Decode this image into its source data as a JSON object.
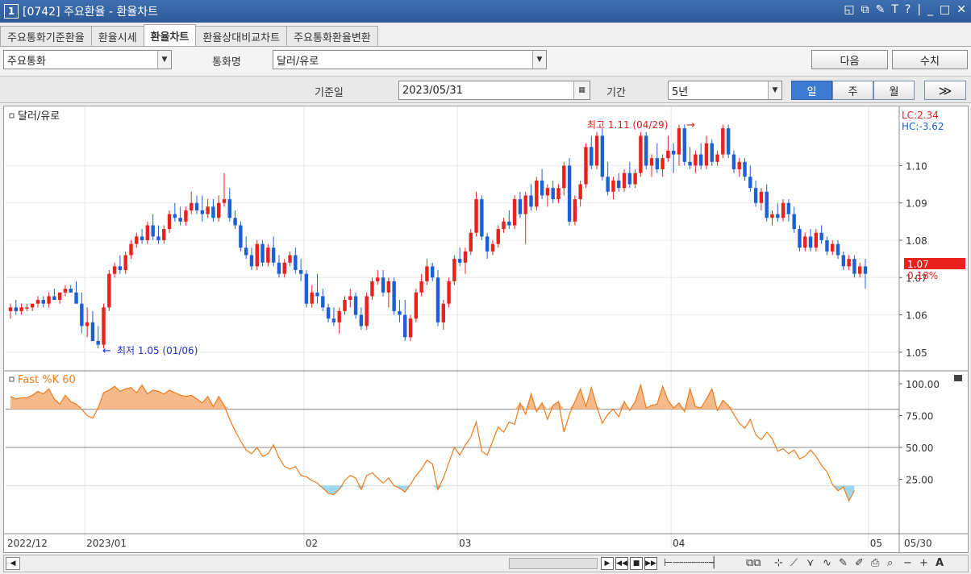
{
  "window": {
    "number": "1",
    "title": "[0742] 주요환율 - 환율차트"
  },
  "title_tools": [
    "◱",
    "⧉",
    "✎",
    "T",
    "?",
    "|",
    "_",
    "□",
    "✕"
  ],
  "tabs": [
    "주요통화기준환율",
    "환율시세",
    "환율차트",
    "환율상대비교차트",
    "주요통화환율변환"
  ],
  "active_tab": 2,
  "filters": {
    "category_value": "주요통화",
    "currency_label": "통화명",
    "currency_value": "달러/유로",
    "next_button": "다음",
    "value_button": "수치",
    "base_date_label": "기준일",
    "base_date_value": "2023/05/31",
    "period_label": "기간",
    "period_value": "5년",
    "period_buttons": [
      "일",
      "주",
      "월"
    ],
    "active_period": 0,
    "more_button": "≫"
  },
  "chart": {
    "series_title": "달러/유로",
    "lc_label": "LC:2.34",
    "hc_label": "HC:-3.62",
    "high_annotation": "최고 1.11 (04/29)",
    "low_annotation": "최저 1.05 (01/06)",
    "price_ticks": [
      "1.10",
      "1.09",
      "1.08",
      "1.07",
      "1.06",
      "1.05"
    ],
    "last_price": "1.07",
    "last_change": "0.18%",
    "osc_title": "Fast %K 60",
    "osc_ticks": [
      "100.00",
      "75.00",
      "50.00",
      "25.00"
    ],
    "date_labels": [
      "2022/12",
      "2023/01",
      "02",
      "03",
      "04",
      "05",
      "05/30"
    ],
    "colors": {
      "up": "#e8231e",
      "down": "#1e5fd6",
      "osc_line": "#f07b1c",
      "osc_fill": "#f5b98a",
      "osc_low_fill": "#9ed7f0",
      "high_text": "#d62020",
      "low_text": "#1e30c8"
    }
  },
  "chart_data": {
    "type": "candlestick",
    "y_range": [
      1.045,
      1.115
    ],
    "candles": [
      [
        1.061,
        1.063,
        1.059,
        1.062
      ],
      [
        1.062,
        1.064,
        1.06,
        1.061
      ],
      [
        1.061,
        1.063,
        1.06,
        1.062
      ],
      [
        1.062,
        1.063,
        1.061,
        1.062
      ],
      [
        1.062,
        1.063,
        1.061,
        1.063
      ],
      [
        1.063,
        1.065,
        1.062,
        1.064
      ],
      [
        1.064,
        1.065,
        1.062,
        1.063
      ],
      [
        1.063,
        1.066,
        1.062,
        1.065
      ],
      [
        1.065,
        1.067,
        1.064,
        1.064
      ],
      [
        1.064,
        1.066,
        1.063,
        1.066
      ],
      [
        1.066,
        1.068,
        1.065,
        1.067
      ],
      [
        1.067,
        1.068,
        1.066,
        1.066
      ],
      [
        1.066,
        1.069,
        1.063,
        1.063
      ],
      [
        1.063,
        1.066,
        1.055,
        1.057
      ],
      [
        1.057,
        1.062,
        1.054,
        1.058
      ],
      [
        1.058,
        1.061,
        1.053,
        1.053
      ],
      [
        1.053,
        1.057,
        1.051,
        1.052
      ],
      [
        1.052,
        1.063,
        1.051,
        1.062
      ],
      [
        1.062,
        1.072,
        1.061,
        1.071
      ],
      [
        1.071,
        1.074,
        1.07,
        1.073
      ],
      [
        1.073,
        1.076,
        1.071,
        1.072
      ],
      [
        1.072,
        1.077,
        1.071,
        1.076
      ],
      [
        1.076,
        1.08,
        1.075,
        1.079
      ],
      [
        1.079,
        1.082,
        1.078,
        1.081
      ],
      [
        1.081,
        1.083,
        1.079,
        1.08
      ],
      [
        1.08,
        1.085,
        1.079,
        1.084
      ],
      [
        1.084,
        1.087,
        1.08,
        1.081
      ],
      [
        1.081,
        1.084,
        1.079,
        1.08
      ],
      [
        1.08,
        1.084,
        1.079,
        1.083
      ],
      [
        1.083,
        1.088,
        1.082,
        1.087
      ],
      [
        1.087,
        1.09,
        1.085,
        1.086
      ],
      [
        1.086,
        1.089,
        1.084,
        1.085
      ],
      [
        1.085,
        1.089,
        1.084,
        1.088
      ],
      [
        1.088,
        1.093,
        1.087,
        1.09
      ],
      [
        1.09,
        1.092,
        1.087,
        1.088
      ],
      [
        1.088,
        1.092,
        1.085,
        1.087
      ],
      [
        1.087,
        1.091,
        1.086,
        1.089
      ],
      [
        1.089,
        1.091,
        1.085,
        1.086
      ],
      [
        1.086,
        1.092,
        1.085,
        1.09
      ],
      [
        1.09,
        1.098,
        1.089,
        1.091
      ],
      [
        1.091,
        1.094,
        1.085,
        1.086
      ],
      [
        1.086,
        1.088,
        1.083,
        1.084
      ],
      [
        1.084,
        1.085,
        1.077,
        1.078
      ],
      [
        1.078,
        1.081,
        1.075,
        1.076
      ],
      [
        1.076,
        1.078,
        1.072,
        1.073
      ],
      [
        1.073,
        1.08,
        1.072,
        1.079
      ],
      [
        1.079,
        1.08,
        1.073,
        1.074
      ],
      [
        1.074,
        1.079,
        1.073,
        1.078
      ],
      [
        1.078,
        1.081,
        1.073,
        1.074
      ],
      [
        1.074,
        1.076,
        1.07,
        1.071
      ],
      [
        1.071,
        1.075,
        1.07,
        1.074
      ],
      [
        1.074,
        1.077,
        1.073,
        1.076
      ],
      [
        1.076,
        1.078,
        1.071,
        1.072
      ],
      [
        1.072,
        1.075,
        1.069,
        1.071
      ],
      [
        1.071,
        1.072,
        1.062,
        1.063
      ],
      [
        1.063,
        1.068,
        1.062,
        1.066
      ],
      [
        1.066,
        1.071,
        1.063,
        1.065
      ],
      [
        1.065,
        1.067,
        1.061,
        1.062
      ],
      [
        1.062,
        1.063,
        1.058,
        1.059
      ],
      [
        1.059,
        1.062,
        1.057,
        1.058
      ],
      [
        1.058,
        1.062,
        1.055,
        1.061
      ],
      [
        1.061,
        1.065,
        1.06,
        1.064
      ],
      [
        1.064,
        1.067,
        1.062,
        1.065
      ],
      [
        1.065,
        1.066,
        1.059,
        1.06
      ],
      [
        1.06,
        1.062,
        1.056,
        1.057
      ],
      [
        1.057,
        1.066,
        1.056,
        1.065
      ],
      [
        1.065,
        1.07,
        1.064,
        1.069
      ],
      [
        1.069,
        1.072,
        1.068,
        1.07
      ],
      [
        1.07,
        1.072,
        1.065,
        1.066
      ],
      [
        1.066,
        1.07,
        1.062,
        1.069
      ],
      [
        1.069,
        1.07,
        1.06,
        1.061
      ],
      [
        1.061,
        1.064,
        1.058,
        1.06
      ],
      [
        1.06,
        1.064,
        1.053,
        1.054
      ],
      [
        1.054,
        1.06,
        1.053,
        1.059
      ],
      [
        1.059,
        1.067,
        1.058,
        1.066
      ],
      [
        1.066,
        1.071,
        1.065,
        1.069
      ],
      [
        1.069,
        1.075,
        1.068,
        1.073
      ],
      [
        1.073,
        1.074,
        1.069,
        1.07
      ],
      [
        1.07,
        1.072,
        1.057,
        1.058
      ],
      [
        1.058,
        1.064,
        1.056,
        1.063
      ],
      [
        1.063,
        1.07,
        1.062,
        1.069
      ],
      [
        1.069,
        1.076,
        1.068,
        1.075
      ],
      [
        1.075,
        1.078,
        1.073,
        1.074
      ],
      [
        1.074,
        1.078,
        1.071,
        1.077
      ],
      [
        1.077,
        1.083,
        1.076,
        1.082
      ],
      [
        1.082,
        1.093,
        1.081,
        1.091
      ],
      [
        1.091,
        1.092,
        1.08,
        1.081
      ],
      [
        1.081,
        1.082,
        1.075,
        1.077
      ],
      [
        1.077,
        1.08,
        1.076,
        1.079
      ],
      [
        1.079,
        1.084,
        1.078,
        1.083
      ],
      [
        1.083,
        1.086,
        1.082,
        1.085
      ],
      [
        1.085,
        1.088,
        1.083,
        1.084
      ],
      [
        1.084,
        1.092,
        1.083,
        1.091
      ],
      [
        1.091,
        1.093,
        1.086,
        1.087
      ],
      [
        1.087,
        1.093,
        1.079,
        1.092
      ],
      [
        1.092,
        1.095,
        1.088,
        1.089
      ],
      [
        1.089,
        1.097,
        1.088,
        1.096
      ],
      [
        1.096,
        1.099,
        1.091,
        1.092
      ],
      [
        1.092,
        1.095,
        1.089,
        1.094
      ],
      [
        1.094,
        1.096,
        1.09,
        1.091
      ],
      [
        1.091,
        1.095,
        1.09,
        1.094
      ],
      [
        1.094,
        1.101,
        1.092,
        1.1
      ],
      [
        1.1,
        1.102,
        1.084,
        1.085
      ],
      [
        1.085,
        1.092,
        1.084,
        1.091
      ],
      [
        1.091,
        1.096,
        1.089,
        1.095
      ],
      [
        1.095,
        1.106,
        1.094,
        1.105
      ],
      [
        1.105,
        1.108,
        1.099,
        1.1
      ],
      [
        1.1,
        1.109,
        1.099,
        1.108
      ],
      [
        1.108,
        1.11,
        1.096,
        1.097
      ],
      [
        1.097,
        1.101,
        1.092,
        1.093
      ],
      [
        1.093,
        1.097,
        1.091,
        1.096
      ],
      [
        1.096,
        1.098,
        1.093,
        1.094
      ],
      [
        1.094,
        1.099,
        1.093,
        1.098
      ],
      [
        1.098,
        1.101,
        1.094,
        1.095
      ],
      [
        1.095,
        1.099,
        1.094,
        1.098
      ],
      [
        1.098,
        1.109,
        1.097,
        1.108
      ],
      [
        1.108,
        1.109,
        1.099,
        1.1
      ],
      [
        1.1,
        1.103,
        1.097,
        1.102
      ],
      [
        1.102,
        1.106,
        1.098,
        1.099
      ],
      [
        1.099,
        1.103,
        1.097,
        1.102
      ],
      [
        1.102,
        1.108,
        1.101,
        1.104
      ],
      [
        1.104,
        1.106,
        1.098,
        1.103
      ],
      [
        1.103,
        1.111,
        1.1,
        1.11
      ],
      [
        1.11,
        1.111,
        1.1,
        1.101
      ],
      [
        1.101,
        1.105,
        1.099,
        1.1
      ],
      [
        1.1,
        1.104,
        1.098,
        1.103
      ],
      [
        1.103,
        1.106,
        1.099,
        1.1
      ],
      [
        1.1,
        1.108,
        1.099,
        1.106
      ],
      [
        1.106,
        1.107,
        1.1,
        1.101
      ],
      [
        1.101,
        1.104,
        1.1,
        1.103
      ],
      [
        1.103,
        1.111,
        1.102,
        1.11
      ],
      [
        1.11,
        1.111,
        1.102,
        1.103
      ],
      [
        1.103,
        1.104,
        1.098,
        1.099
      ],
      [
        1.099,
        1.102,
        1.097,
        1.101
      ],
      [
        1.101,
        1.102,
        1.096,
        1.097
      ],
      [
        1.097,
        1.1,
        1.093,
        1.094
      ],
      [
        1.094,
        1.096,
        1.089,
        1.09
      ],
      [
        1.09,
        1.094,
        1.088,
        1.093
      ],
      [
        1.093,
        1.095,
        1.085,
        1.086
      ],
      [
        1.086,
        1.088,
        1.084,
        1.087
      ],
      [
        1.087,
        1.09,
        1.085,
        1.086
      ],
      [
        1.086,
        1.091,
        1.085,
        1.09
      ],
      [
        1.09,
        1.091,
        1.085,
        1.087
      ],
      [
        1.087,
        1.089,
        1.082,
        1.083
      ],
      [
        1.083,
        1.084,
        1.077,
        1.078
      ],
      [
        1.078,
        1.082,
        1.077,
        1.081
      ],
      [
        1.081,
        1.083,
        1.077,
        1.078
      ],
      [
        1.078,
        1.083,
        1.077,
        1.082
      ],
      [
        1.082,
        1.084,
        1.079,
        1.08
      ],
      [
        1.08,
        1.081,
        1.076,
        1.077
      ],
      [
        1.077,
        1.08,
        1.076,
        1.079
      ],
      [
        1.079,
        1.08,
        1.075,
        1.076
      ],
      [
        1.076,
        1.077,
        1.072,
        1.073
      ],
      [
        1.073,
        1.076,
        1.072,
        1.075
      ],
      [
        1.075,
        1.076,
        1.07,
        1.071
      ],
      [
        1.071,
        1.074,
        1.07,
        1.073
      ],
      [
        1.073,
        1.075,
        1.067,
        1.071
      ]
    ],
    "osc_values": [
      90,
      88,
      89,
      89,
      91,
      94,
      92,
      96,
      88,
      84,
      91,
      86,
      84,
      80,
      75,
      73,
      81,
      93,
      95,
      98,
      94,
      96,
      97,
      93,
      99,
      92,
      95,
      94,
      92,
      95,
      93,
      91,
      90,
      91,
      88,
      85,
      90,
      82,
      90,
      83,
      72,
      63,
      55,
      48,
      45,
      50,
      43,
      45,
      52,
      42,
      35,
      33,
      35,
      28,
      27,
      24,
      22,
      18,
      14,
      13,
      17,
      24,
      28,
      26,
      17,
      28,
      30,
      26,
      22,
      26,
      20,
      18,
      15,
      21,
      28,
      33,
      40,
      37,
      17,
      26,
      38,
      50,
      44,
      52,
      58,
      70,
      47,
      44,
      55,
      66,
      62,
      70,
      68,
      85,
      76,
      92,
      78,
      85,
      72,
      83,
      86,
      62,
      76,
      86,
      96,
      82,
      97,
      82,
      69,
      76,
      80,
      74,
      86,
      79,
      86,
      99,
      81,
      83,
      84,
      98,
      87,
      81,
      85,
      78,
      96,
      82,
      81,
      88,
      96,
      79,
      87,
      83,
      76,
      69,
      65,
      72,
      60,
      56,
      62,
      57,
      47,
      49,
      45,
      48,
      41,
      43,
      48,
      43,
      36,
      31,
      21,
      16,
      19,
      8,
      16
    ]
  }
}
